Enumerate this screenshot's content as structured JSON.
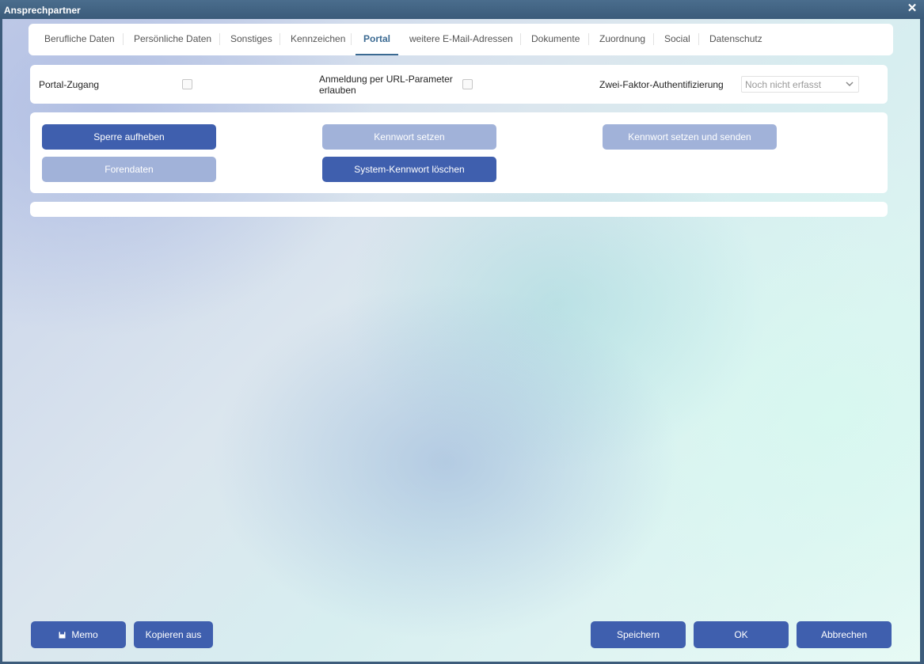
{
  "window": {
    "title": "Ansprechpartner"
  },
  "tabs": [
    {
      "label": "Berufliche Daten",
      "active": false
    },
    {
      "label": "Persönliche Daten",
      "active": false
    },
    {
      "label": "Sonstiges",
      "active": false
    },
    {
      "label": "Kennzeichen",
      "active": false
    },
    {
      "label": "Portal",
      "active": true
    },
    {
      "label": "weitere E-Mail-Adressen",
      "active": false
    },
    {
      "label": "Dokumente",
      "active": false
    },
    {
      "label": "Zuordnung",
      "active": false
    },
    {
      "label": "Social",
      "active": false
    },
    {
      "label": "Datenschutz",
      "active": false
    }
  ],
  "portal": {
    "access_label": "Portal-Zugang",
    "access_checked": false,
    "url_login_label_line1": "Anmeldung per URL-Parameter",
    "url_login_label_line2": "erlauben",
    "url_login_checked": false,
    "twofa_label": "Zwei-Faktor-Authentifizierung",
    "twofa_value": "Noch nicht erfasst"
  },
  "actions": {
    "unlock": "Sperre aufheben",
    "set_password": "Kennwort setzen",
    "set_and_send_password": "Kennwort setzen und senden",
    "forum_data": "Forendaten",
    "delete_system_password": "System-Kennwort löschen"
  },
  "footer": {
    "memo": "Memo",
    "copy_from": "Kopieren aus",
    "save": "Speichern",
    "ok": "OK",
    "cancel": "Abbrechen"
  },
  "colors": {
    "primary_button": "#3f5fae",
    "disabled_button": "#a1b2d9",
    "titlebar": "#3d5c7b",
    "active_tab": "#3b6a92"
  },
  "icons": {
    "close": "close-icon",
    "memo": "memo-icon",
    "select_chevron": "chevron-down-icon"
  }
}
